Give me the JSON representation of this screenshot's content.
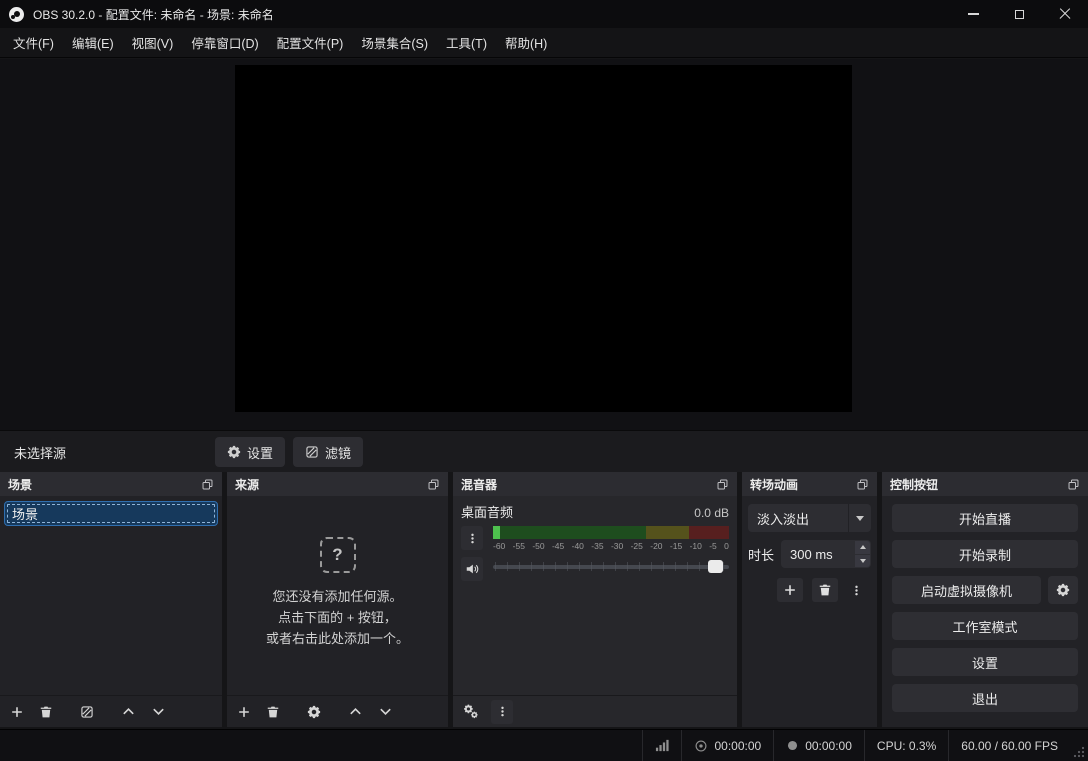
{
  "window": {
    "title": "OBS 30.2.0 - 配置文件: 未命名 - 场景: 未命名"
  },
  "menu": {
    "items": [
      "文件(F)",
      "编辑(E)",
      "视图(V)",
      "停靠窗口(D)",
      "配置文件(P)",
      "场景集合(S)",
      "工具(T)",
      "帮助(H)"
    ]
  },
  "source_toolbar": {
    "status": "未选择源",
    "settings": "设置",
    "filters": "滤镜"
  },
  "scenes": {
    "title": "场景",
    "items": [
      "场景"
    ]
  },
  "sources": {
    "title": "来源",
    "empty_icon": "?",
    "empty": [
      "您还没有添加任何源。",
      "点击下面的 + 按钮，",
      "或者右击此处添加一个。"
    ]
  },
  "mixer": {
    "title": "混音器",
    "channel": "桌面音频",
    "level": "0.0 dB",
    "ticks": [
      "-60",
      "-55",
      "-50",
      "-45",
      "-40",
      "-35",
      "-30",
      "-25",
      "-20",
      "-15",
      "-10",
      "-5",
      "0"
    ]
  },
  "transitions": {
    "title": "转场动画",
    "current": "淡入淡出",
    "duration_label": "时长",
    "duration": "300 ms"
  },
  "controls": {
    "title": "控制按钮",
    "stream": "开始直播",
    "record": "开始录制",
    "virtual_cam": "启动虚拟摄像机",
    "studio_mode": "工作室模式",
    "settings": "设置",
    "exit": "退出"
  },
  "statusbar": {
    "stream_time": "00:00:00",
    "record_time": "00:00:00",
    "cpu": "CPU: 0.3%",
    "fps": "60.00 / 60.00 FPS"
  },
  "colors": {
    "accent": "#2f6fb0",
    "meter_green_dim": "#1e4d1e",
    "meter_yellow_dim": "#55521c",
    "meter_red_dim": "#571f1f",
    "meter_active": "#4ec04e"
  }
}
